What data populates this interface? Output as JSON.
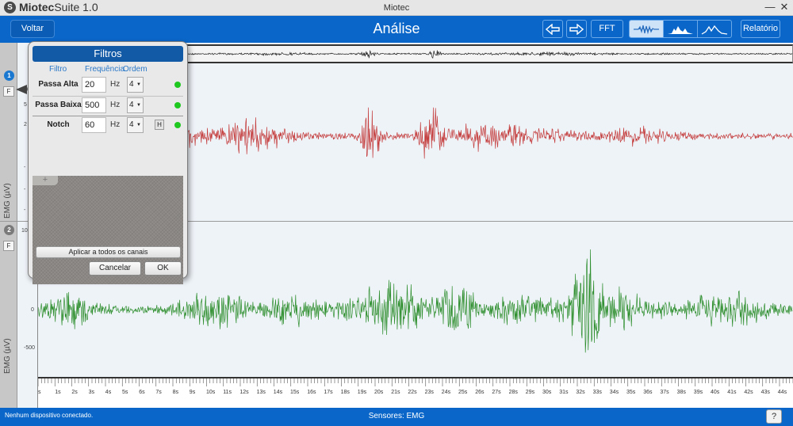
{
  "app": {
    "logo": "S",
    "name_part1": "Miotec",
    "name_part2": "Suite 1.0",
    "window_title": "Miotec",
    "minimize": "—",
    "close": "✕"
  },
  "header": {
    "back_label": "Voltar",
    "title": "Análise",
    "prev_icon": "arrow-left-icon",
    "next_icon": "arrow-right-icon",
    "fft_label": "FFT",
    "report_label": "Relatório"
  },
  "channels": [
    {
      "number": "1",
      "filter_btn": "F",
      "ylabel": "EMG (µV)",
      "color": "#c43c3c",
      "badge_color": "#1a78d0",
      "ticks": [
        "10",
        "5",
        "2",
        "-",
        "-",
        "-"
      ]
    },
    {
      "number": "2",
      "filter_btn": "F",
      "ylabel": "EMG (µV)",
      "color": "#2f8f2f",
      "badge_color": "#7a7a7a",
      "ticks": [
        "10",
        "0",
        "-500"
      ]
    }
  ],
  "timeline": {
    "ticks": [
      "s",
      "1s",
      "2s",
      "3s",
      "4s",
      "5s",
      "6s",
      "7s",
      "8s",
      "9s",
      "10s",
      "11s",
      "12s",
      "13s",
      "14s",
      "15s",
      "16s",
      "17s",
      "18s",
      "19s",
      "20s",
      "21s",
      "22s",
      "23s",
      "24s",
      "25s",
      "26s",
      "27s",
      "28s",
      "29s",
      "30s",
      "31s",
      "32s",
      "33s",
      "34s",
      "35s",
      "36s",
      "37s",
      "38s",
      "39s",
      "40s",
      "41s",
      "42s",
      "43s",
      "44s",
      "4"
    ]
  },
  "filters_dialog": {
    "title": "Filtros",
    "headers": {
      "filter": "Filtro",
      "frequency": "Frequência",
      "order": "Ordem"
    },
    "rows": [
      {
        "name": "Passa Alta",
        "value": "20",
        "unit": "Hz",
        "order": "4",
        "status": "active"
      },
      {
        "name": "Passa Baixa",
        "value": "500",
        "unit": "Hz",
        "order": "4",
        "status": "active"
      },
      {
        "name": "Notch",
        "value": "60",
        "unit": "Hz",
        "order": "4",
        "harmonic_btn": "H",
        "status": "active"
      }
    ],
    "add_label": "+",
    "apply_all_label": "Aplicar a todos os canais",
    "cancel_label": "Cancelar",
    "ok_label": "OK"
  },
  "status": {
    "left": "Nenhum dispositivo conectado.",
    "center": "Sensores: EMG",
    "help": "?"
  },
  "colors": {
    "accent": "#0a67c9",
    "ch1_signal": "#c43c3c",
    "ch2_signal": "#2f8f2f",
    "led_active": "#1fc81f"
  }
}
